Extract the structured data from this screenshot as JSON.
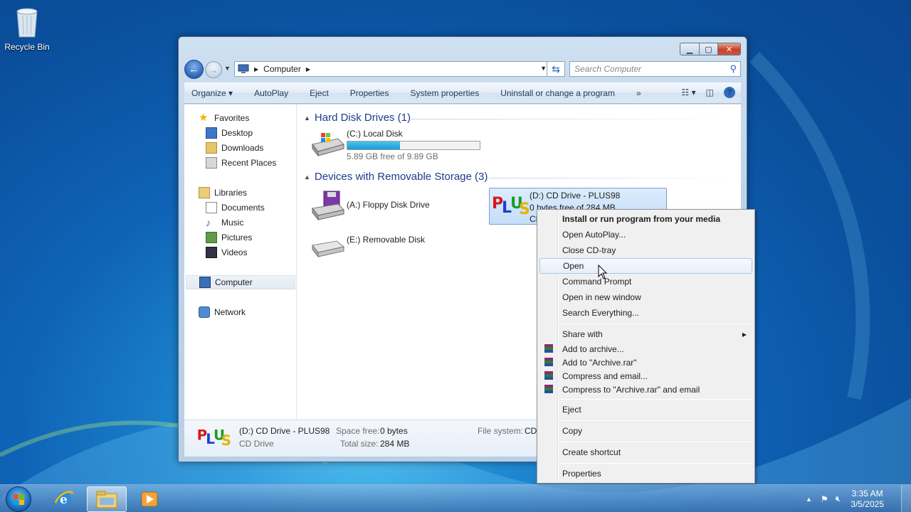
{
  "desktop": {
    "recycle_bin": "Recycle Bin"
  },
  "window": {
    "address": {
      "crumb": "Computer"
    },
    "search": {
      "placeholder": "Search Computer"
    },
    "toolbar": {
      "organize": "Organize",
      "autoplay": "AutoPlay",
      "eject": "Eject",
      "properties": "Properties",
      "system_properties": "System properties",
      "uninstall": "Uninstall or change a program",
      "more": "»"
    },
    "nav": {
      "favorites": "Favorites",
      "desktop": "Desktop",
      "downloads": "Downloads",
      "recent_places": "Recent Places",
      "libraries": "Libraries",
      "documents": "Documents",
      "music": "Music",
      "pictures": "Pictures",
      "videos": "Videos",
      "computer": "Computer",
      "network": "Network"
    },
    "groups": {
      "hdd": "Hard Disk Drives (1)",
      "removable": "Devices with Removable Storage (3)"
    },
    "drives": {
      "c": {
        "name": "(C:) Local Disk",
        "free": "5.89 GB free of 9.89 GB",
        "used_fraction": 0.4
      },
      "a": {
        "name": "(A:) Floppy Disk Drive"
      },
      "e": {
        "name": "(E:) Removable Disk"
      },
      "d": {
        "name": "(D:) CD Drive - PLUS98",
        "free": "0 bytes free of 284 MB",
        "fs_short": "CD"
      }
    },
    "details": {
      "name": "(D:) CD Drive - PLUS98",
      "type": "CD Drive",
      "space_free_label": "Space free:",
      "space_free_value": "0 bytes",
      "total_size_label": "Total size:",
      "total_size_value": "284 MB",
      "fs_label": "File system:",
      "fs_value": "CD"
    }
  },
  "context_menu": {
    "install": "Install or run program from your media",
    "open_autoplay": "Open AutoPlay...",
    "close_tray": "Close CD-tray",
    "open": "Open",
    "command_prompt": "Command Prompt",
    "open_new_window": "Open in new window",
    "search_everything": "Search Everything...",
    "share_with": "Share with",
    "add_archive": "Add to archive...",
    "add_archive_rar": "Add to \"Archive.rar\"",
    "compress_email": "Compress and email...",
    "compress_rar_email": "Compress to \"Archive.rar\" and email",
    "eject": "Eject",
    "copy": "Copy",
    "create_shortcut": "Create shortcut",
    "properties": "Properties"
  },
  "taskbar": {
    "time": "3:35 AM",
    "date": "3/5/2025"
  }
}
